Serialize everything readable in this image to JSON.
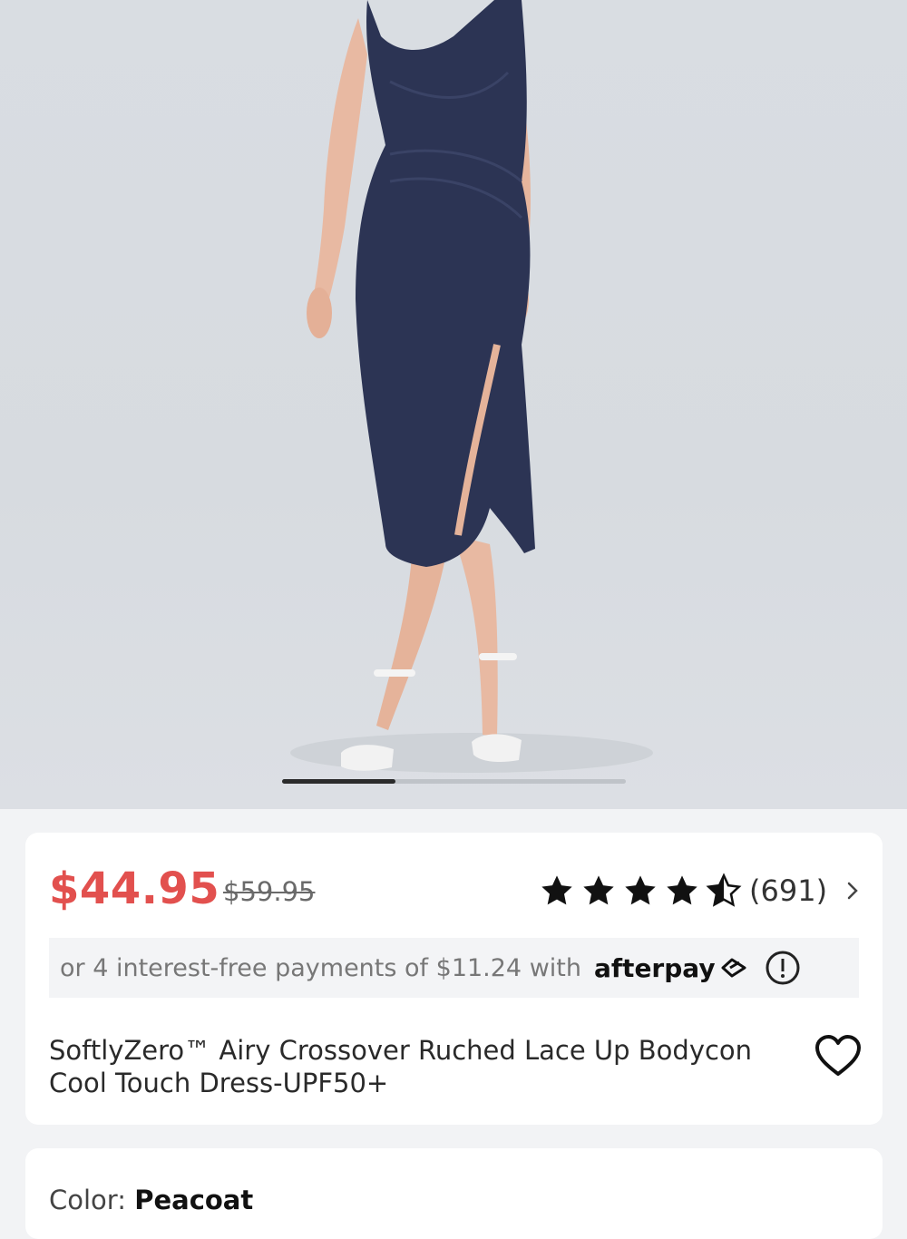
{
  "gallery": {
    "image_alt": "Model wearing navy midi bodycon dress with side slit and white strappy heels",
    "progress": 0.33
  },
  "price": {
    "sale": "$44.95",
    "original": "$59.95",
    "sale_color": "#e2504e"
  },
  "rating": {
    "stars": 4.5,
    "count": "(691)"
  },
  "afterpay": {
    "text": "or 4 interest-free payments of $11.24 with",
    "brand": "afterpay"
  },
  "product": {
    "title": "SoftlyZero™ Airy Crossover Ruched Lace Up Bodycon Cool Touch Dress-UPF50+"
  },
  "color": {
    "label": "Color: ",
    "value": "Peacoat"
  },
  "icons": [
    "star-icon",
    "chevron-right-icon",
    "afterpay-logo-icon",
    "info-icon",
    "heart-icon"
  ]
}
